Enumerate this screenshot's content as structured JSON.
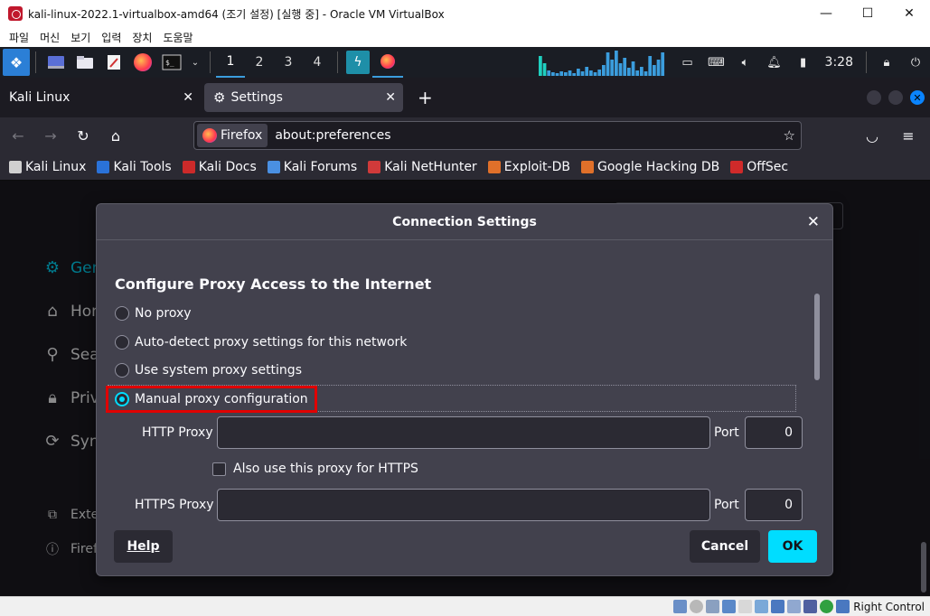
{
  "vbox": {
    "title": "kali-linux-2022.1-virtualbox-amd64 (조기 설정) [실행 중] - Oracle VM VirtualBox",
    "menu": [
      "파일",
      "머신",
      "보기",
      "입력",
      "장치",
      "도움말"
    ],
    "window_buttons": {
      "minimize": "—",
      "maximize": "☐",
      "close": "✕"
    },
    "status_host_key": "Right Control"
  },
  "kali_panel": {
    "workspaces": [
      "1",
      "2",
      "3",
      "4"
    ],
    "active_workspace": 0,
    "clock": "3:28",
    "cpu_graph": [
      22,
      14,
      6,
      4,
      3,
      5,
      4,
      6,
      3,
      8,
      5,
      10,
      6,
      4,
      7,
      12,
      26,
      18,
      28,
      14,
      20,
      9,
      16,
      6,
      10,
      5,
      22,
      12,
      18,
      26
    ],
    "accent": "#3b9ddd"
  },
  "firefox": {
    "tabs": [
      {
        "label": "Kali Linux",
        "close": "✕"
      },
      {
        "label": "Settings",
        "close": "✕"
      }
    ],
    "new_tab": "+",
    "url_badge": "Firefox",
    "url": "about:preferences",
    "bookmarks": [
      {
        "label": "Kali Linux",
        "color": "#d0d0d0"
      },
      {
        "label": "Kali Tools",
        "color": "#2a72d9"
      },
      {
        "label": "Kali Docs",
        "color": "#cc2a2a"
      },
      {
        "label": "Kali Forums",
        "color": "#4a90e2"
      },
      {
        "label": "Kali NetHunter",
        "color": "#d03a3a"
      },
      {
        "label": "Exploit-DB",
        "color": "#e0702a"
      },
      {
        "label": "Google Hacking DB",
        "color": "#e0702a"
      },
      {
        "label": "OffSec",
        "color": "#d02a2a"
      }
    ],
    "sidebar": {
      "items": [
        "General",
        "Home",
        "Search",
        "Privacy & Security",
        "Sync"
      ],
      "visible_items": [
        "Gen",
        "Hon",
        "Sea",
        "Priv",
        "Syn"
      ],
      "footer_items": [
        "Exte",
        "Firef"
      ]
    }
  },
  "dialog": {
    "title": "Connection Settings",
    "close": "✕",
    "section_title": "Configure Proxy Access to the Internet",
    "options": [
      {
        "label": "No proxy",
        "checked": false
      },
      {
        "label": "Auto-detect proxy settings for this network",
        "checked": false
      },
      {
        "label": "Use system proxy settings",
        "checked": false
      },
      {
        "label": "Manual proxy configuration",
        "checked": true
      }
    ],
    "http_proxy_label": "HTTP Proxy",
    "http_proxy_value": "",
    "http_port_label": "Port",
    "http_port_value": "0",
    "also_https_label": "Also use this proxy for HTTPS",
    "also_https_checked": false,
    "https_proxy_label": "HTTPS Proxy",
    "https_proxy_value": "",
    "https_port_label": "Port",
    "https_port_value": "0",
    "help_label": "Help",
    "cancel_label": "Cancel",
    "ok_label": "OK",
    "accent": "#00ddff",
    "highlight_color": "#e00000"
  }
}
